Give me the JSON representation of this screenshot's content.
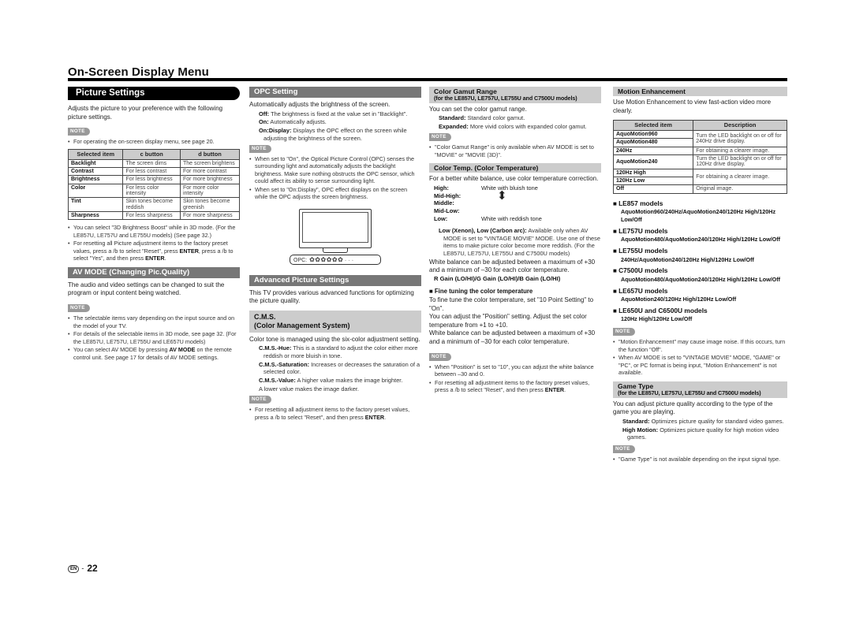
{
  "page_title": "On-Screen Display Menu",
  "footer": {
    "lang_badge": "EN",
    "separator": "-",
    "page_number": "22"
  },
  "note_label": "NOTE",
  "col1": {
    "heading": "Picture Settings",
    "intro": "Adjusts the picture to your preference with the following picture settings.",
    "note1": "For operating the on-screen display menu, see page 20.",
    "table": {
      "headers": [
        "Selected item",
        "c  button",
        "d  button"
      ],
      "rows": [
        [
          "Backlight",
          "The screen dims",
          "The screen brightens"
        ],
        [
          "Contrast",
          "For less contrast",
          "For more contrast"
        ],
        [
          "Brightness",
          "For less brightness",
          "For more brightness"
        ],
        [
          "Color",
          "For less color intensity",
          "For more color intensity"
        ],
        [
          "Tint",
          "Skin tones become reddish",
          "Skin tones become greenish"
        ],
        [
          "Sharpness",
          "For less sharpness",
          "For more sharpness"
        ]
      ]
    },
    "bullets": [
      "You can select \"3D Brightness Boost\" while in 3D mode. (For the LE857U, LE757U and LE755U models) (See page 32.)",
      "For resetting all Picture adjustment items to the factory preset values, press a /b  to select \"Reset\", press ENTER, press a /b  to select \"Yes\", and then press ENTER."
    ],
    "avmode": {
      "heading": "AV MODE (Changing Pic.Quality)",
      "intro": "The audio and video settings can be changed to suit the program or input content being watched.",
      "notes": [
        "The selectable items vary depending on the input source and on the model of your TV.",
        "For details of the selectable items in 3D mode, see page 32. (For the LE857U, LE757U, LE755U and LE657U models)",
        "You can select AV MODE by pressing AV MODE on the remote control unit. See page 17 for details of AV MODE settings."
      ]
    }
  },
  "col2": {
    "opc": {
      "heading": "OPC Setting",
      "intro": "Automatically adjusts the brightness of the screen.",
      "defs": [
        {
          "term": "Off:",
          "desc": "The brightness is fixed at the value set in \"Backlight\"."
        },
        {
          "term": "On:",
          "desc": "Automatically adjusts."
        },
        {
          "term": "On:Display:",
          "desc": "Displays the OPC effect on the screen while adjusting the brightness of the screen."
        }
      ],
      "notes": [
        "When set to \"On\", the Optical Picture Control (OPC) senses the surrounding light and automatically adjusts the backlight brightness. Make sure nothing obstructs the OPC sensor, which could affect its ability to sense surrounding light.",
        "When set to \"On:Display\", OPC effect displays on the screen while the OPC adjusts the screen brightness."
      ],
      "figure_label": "OPC:",
      "figure_level_filled": 6,
      "figure_level_total": 9
    },
    "advanced": {
      "heading": "Advanced Picture Settings",
      "intro": "This TV provides various advanced functions for optimizing the picture quality."
    },
    "cms": {
      "heading_line1": "C.M.S.",
      "heading_line2": "(Color Management System)",
      "intro": "Color tone is managed using the six-color adjustment setting.",
      "defs": [
        {
          "term": "C.M.S.-Hue:",
          "desc": "This is a standard to adjust the color either more reddish or more bluish in tone."
        },
        {
          "term": "C.M.S.-Saturation:",
          "desc": "Increases or decreases the saturation of a selected color."
        },
        {
          "term": "C.M.S.-Value:",
          "desc": "A higher value makes the image brighter."
        }
      ],
      "after": "A lower value makes the image darker.",
      "note": "For resetting all adjustment items to the factory preset values, press a /b  to select \"Reset\", and then press ENTER."
    }
  },
  "col3": {
    "gamut": {
      "heading": "Color Gamut Range",
      "subheading": "(for the LE857U, LE757U, LE755U and C7500U models)",
      "intro": "You can set the color gamut range.",
      "defs": [
        {
          "term": "Standard:",
          "desc": "Standard color gamut."
        },
        {
          "term": "Expanded:",
          "desc": "More vivid colors with expanded color gamut."
        }
      ],
      "note": "\"Color Gamut Range\" is only available when AV MODE is set to \"MOVIE\" or \"MOVIE (3D)\"."
    },
    "temp": {
      "heading": "Color Temp. (Color Temperature)",
      "intro": "For a better white balance, use color temperature correction.",
      "levels": [
        {
          "term": "High:",
          "desc": "White with bluish tone"
        },
        {
          "term": "Mid-High:",
          "desc": ""
        },
        {
          "term": "Middle:",
          "desc": ""
        },
        {
          "term": "Mid-Low:",
          "desc": ""
        },
        {
          "term": "Low:",
          "desc": "White with reddish tone"
        }
      ],
      "low_def_term": "Low (Xenon), Low (Carbon arc):",
      "low_def_desc": "Available only when AV MODE is set to \"VINTAGE MOVIE\" MODE. Use one of these items to make picture color become more reddish. (For the LE857U, LE757U, LE755U and C7500U models)",
      "balance": "White balance can be adjusted between a maximum of +30 and a minimum of –30 for each color temperature.",
      "gains": "R Gain (LO/HI)/G Gain (LO/HI)/B Gain (LO/HI)",
      "fine_heading": "Fine tuning the color temperature",
      "fine_p1": "To fine tune the color temperature, set \"10 Point Setting\" to \"On\".",
      "fine_p2": "You can adjust the \"Position\" setting. Adjust the set color temperature from +1 to +10.",
      "fine_p3": "White balance can be adjusted between a maximum of +30 and a minimum of –30 for each color temperature.",
      "notes": [
        "When \"Position\" is set to \"10\", you can adjust the white balance between –30 and 0.",
        "For resetting all adjustment items to the factory preset values, press a /b  to select \"Reset\", and then press ENTER."
      ]
    }
  },
  "col4": {
    "motion": {
      "heading": "Motion Enhancement",
      "intro": "Use Motion Enhancement to view fast-action video more clearly.",
      "table_headers": [
        "Selected item",
        "Description"
      ],
      "rows": [
        {
          "item": "AquoMotion960",
          "desc": "Turn the LED backlight on or off for 240Hz drive display.",
          "span": 2
        },
        {
          "item": "AquoMotion480"
        },
        {
          "item": "240Hz",
          "desc": "For obtaining a clearer image.",
          "span": 1
        },
        {
          "item": "AquoMotion240",
          "desc": "Turn the LED backlight on or off for 120Hz drive display.",
          "span": 1
        },
        {
          "item": "120Hz High",
          "desc": "For obtaining a clearer image.",
          "span": 2
        },
        {
          "item": "120Hz Low"
        },
        {
          "item": "Off",
          "desc": "Original image.",
          "span": 1
        }
      ],
      "models": [
        {
          "name": "LE857 models",
          "list": "AquoMotion960/240Hz/AquoMotion240/120Hz High/120Hz Low/Off"
        },
        {
          "name": "LE757U models",
          "list": "AquoMotion480/AquoMotion240/120Hz High/120Hz Low/Off"
        },
        {
          "name": "LE755U models",
          "list": "240Hz/AquoMotion240/120Hz High/120Hz Low/Off"
        },
        {
          "name": "C7500U models",
          "list": "AquoMotion480/AquoMotion240/120Hz High/120Hz Low/Off"
        },
        {
          "name": "LE657U models",
          "list": "AquoMotion240/120Hz High/120Hz Low/Off"
        },
        {
          "name": "LE650U and C6500U models",
          "list": "120Hz High/120Hz Low/Off"
        }
      ],
      "notes": [
        "\"Motion Enhancement\" may cause image noise. If this occurs, turn the function \"Off\".",
        "When AV MODE is set to \"VINTAGE MOVIE\" MODE, \"GAME\" or \"PC\", or PC format is being input, \"Motion Enhancement\" is not available."
      ]
    },
    "game": {
      "heading": "Game Type",
      "subheading": "(for the LE857U, LE757U, LE755U and C7500U models)",
      "intro": "You can adjust picture quality according to the type of the game you are playing.",
      "defs": [
        {
          "term": "Standard:",
          "desc": "Optimizes picture quality for standard video games."
        },
        {
          "term": "High Motion:",
          "desc": "Optimizes picture quality for high motion video games."
        }
      ],
      "note": "\"Game Type\" is not available depending on the input signal type."
    }
  }
}
